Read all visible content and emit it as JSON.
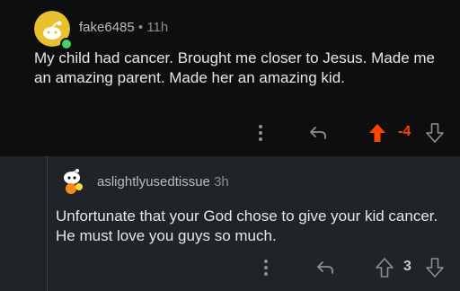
{
  "top_comment": {
    "author": "fake6485",
    "separator": " • ",
    "age": "11h",
    "body": "My child had cancer.   Brought me closer to Jesus. Made me an amazing parent.  Made her an amazing kid.",
    "score": "-4",
    "avatar_icon": "snoo-avatar-icon",
    "vote_state": "upvoted",
    "accent_color": "#ff4500"
  },
  "reply_comment": {
    "author": "aslightlyusedtissue",
    "age": "3h",
    "body": "Unfortunate that your God chose to give your kid cancer. He must love you guys so much.",
    "score": "3",
    "avatar_icon": "snoo-avatar-icon",
    "vote_state": "none"
  },
  "actions": {
    "more_icon": "more-vertical-icon",
    "reply_icon": "reply-arrow-icon",
    "upvote_icon": "upvote-arrow-icon",
    "downvote_icon": "downvote-arrow-icon"
  }
}
